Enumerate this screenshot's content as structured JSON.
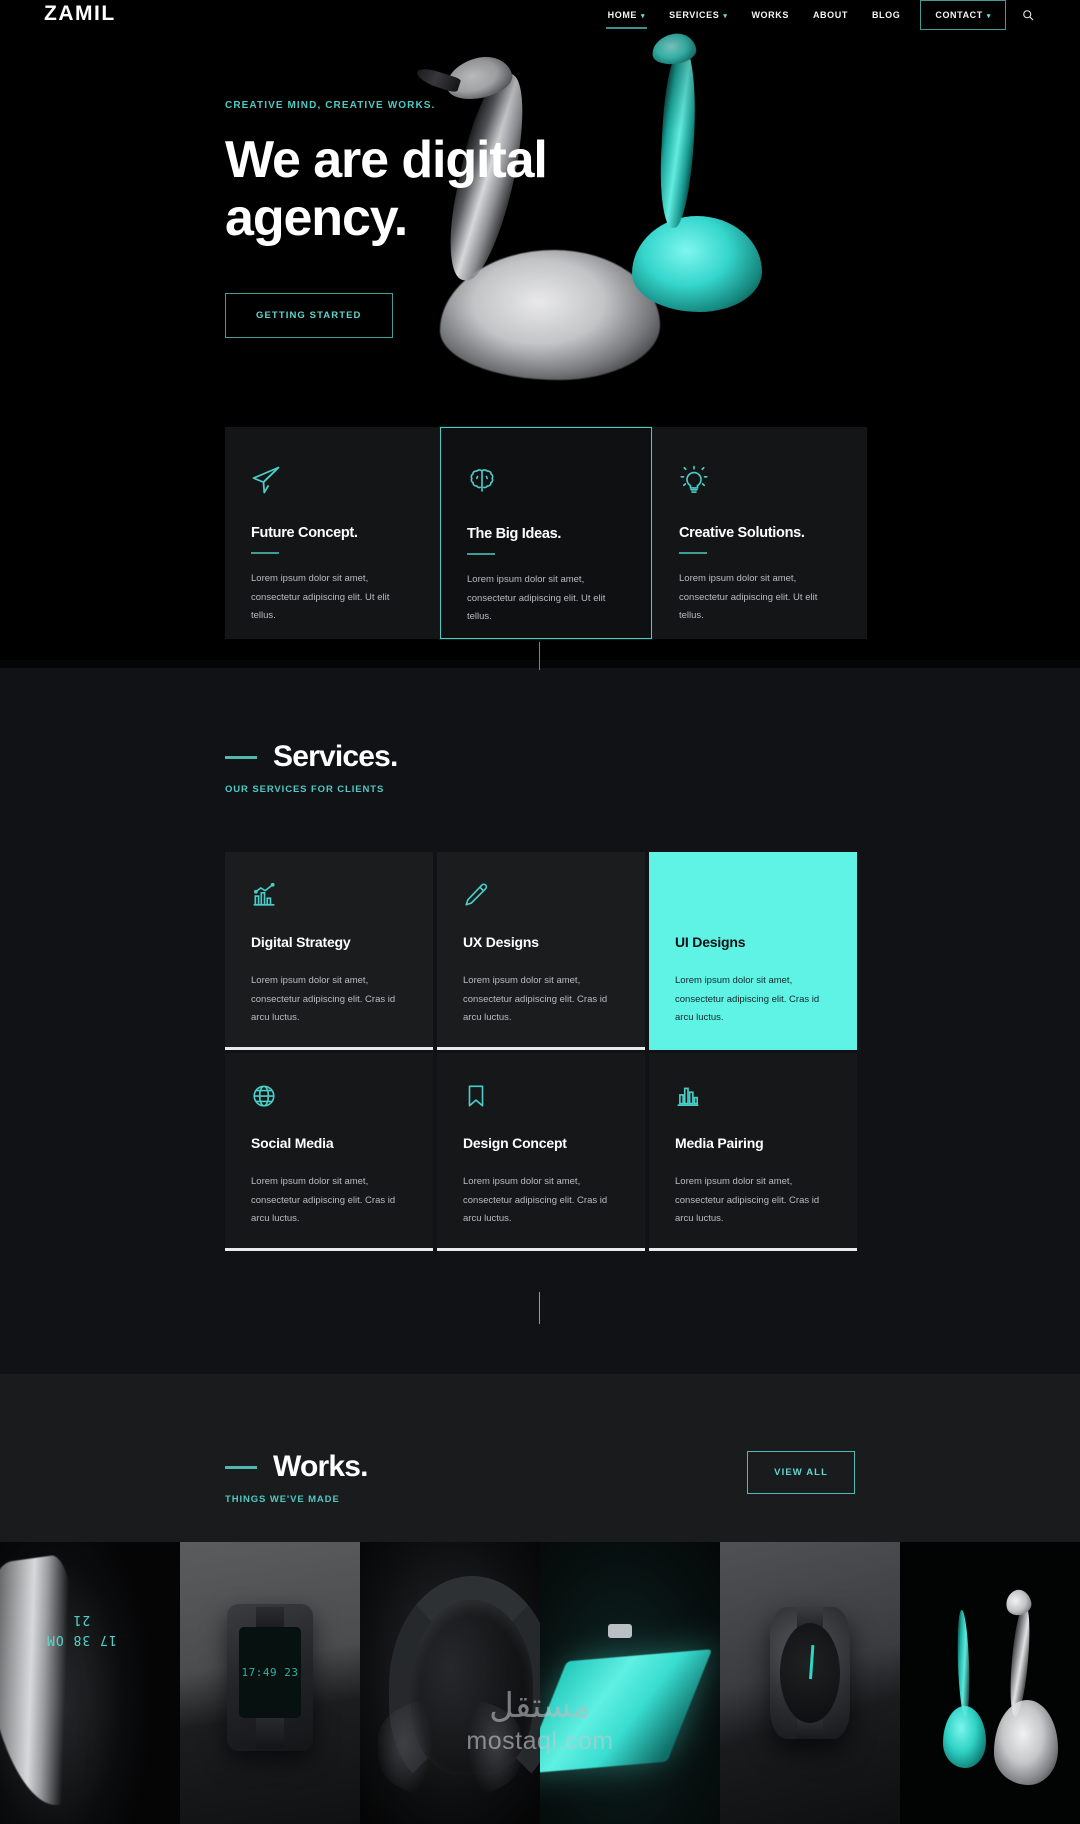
{
  "header": {
    "logo": "ZAMIL",
    "nav": [
      {
        "label": "HOME",
        "caret": "▾",
        "active": true,
        "boxed": false
      },
      {
        "label": "SERVICES",
        "caret": "▾",
        "active": false,
        "boxed": false
      },
      {
        "label": "WORKS",
        "caret": "",
        "active": false,
        "boxed": false
      },
      {
        "label": "ABOUT",
        "caret": "",
        "active": false,
        "boxed": false
      },
      {
        "label": "BLOG",
        "caret": "",
        "active": false,
        "boxed": false
      },
      {
        "label": "CONTACT",
        "caret": "▾",
        "active": false,
        "boxed": true
      }
    ],
    "search_icon": "search-icon"
  },
  "hero": {
    "kicker": "CREATIVE MIND, CREATIVE WORKS.",
    "title_line1": "We are digital",
    "title_line2": "agency.",
    "cta": "GETTING STARTED"
  },
  "features": [
    {
      "icon": "paper-plane-icon",
      "title": "Future Concept.",
      "text": "Lorem ipsum dolor sit amet, consectetur adipiscing elit. Ut elit tellus.",
      "highlight": false
    },
    {
      "icon": "brain-icon",
      "title": "The Big Ideas.",
      "text": "Lorem ipsum dolor sit amet, consectetur adipiscing elit. Ut elit tellus.",
      "highlight": true
    },
    {
      "icon": "lightbulb-icon",
      "title": "Creative Solutions.",
      "text": "Lorem ipsum dolor sit amet, consectetur adipiscing elit. Ut elit tellus.",
      "highlight": false
    }
  ],
  "services": {
    "heading": "Services.",
    "subheading": "OUR SERVICES FOR CLIENTS",
    "cards": [
      {
        "icon": "chart-growth-icon",
        "title": "Digital Strategy",
        "text": "Lorem ipsum dolor sit amet, consectetur adipiscing elit. Cras id arcu luctus.",
        "accent": false
      },
      {
        "icon": "pencil-icon",
        "title": "UX Designs",
        "text": "Lorem ipsum dolor sit amet, consectetur adipiscing elit. Cras id arcu luctus.",
        "accent": false
      },
      {
        "icon": "none",
        "title": "UI Designs",
        "text": "Lorem ipsum dolor sit amet, consectetur adipiscing elit. Cras id arcu luctus.",
        "accent": true
      },
      {
        "icon": "globe-icon",
        "title": "Social Media",
        "text": "Lorem ipsum dolor sit amet, consectetur adipiscing elit. Cras id arcu luctus.",
        "accent": false
      },
      {
        "icon": "bookmark-icon",
        "title": "Design Concept",
        "text": "Lorem ipsum dolor sit amet, consectetur adipiscing elit. Cras id arcu luctus.",
        "accent": false
      },
      {
        "icon": "bar-chart-icon",
        "title": "Media Pairing",
        "text": "Lorem ipsum dolor sit amet, consectetur adipiscing elit. Cras id arcu luctus.",
        "accent": false
      }
    ]
  },
  "works": {
    "heading": "Works.",
    "subheading": "THINGS WE'VE MADE",
    "view_all": "VIEW ALL",
    "tiles": [
      {
        "name": "fitness-band-teal-display"
      },
      {
        "name": "square-digital-watch"
      },
      {
        "name": "black-headphones"
      },
      {
        "name": "teal-glowing-keyboard"
      },
      {
        "name": "round-analog-watch"
      },
      {
        "name": "teal-and-grey-flamingos"
      }
    ],
    "tile_1_display_text": "17 38 OM 21",
    "tile_2_display_text": "17:49 23"
  },
  "watermark": {
    "arabic": "مستقل",
    "latin": "mostaql.com"
  },
  "colors": {
    "accent": "#5ff3e5",
    "accent_dim": "#4fc9c4",
    "accent_border": "#3f9c97",
    "bg_hero": "#000000",
    "bg_services": "#101216",
    "bg_works": "#1a1b1d",
    "card_bg": "#1b1c1e",
    "text_primary": "#ffffff",
    "text_muted": "#b9bcc0"
  }
}
